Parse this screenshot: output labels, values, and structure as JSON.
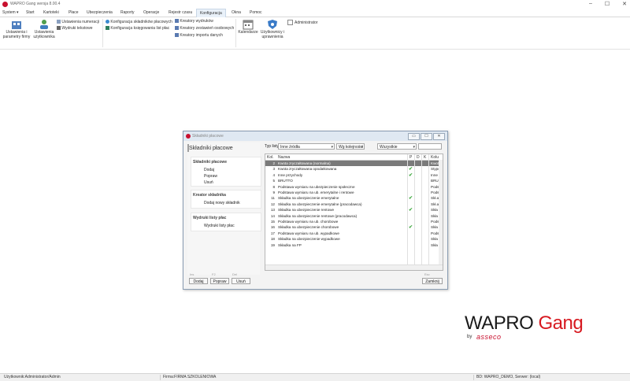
{
  "window": {
    "title": "WAPRO Gang wersja 8.00.4",
    "controls": [
      "–",
      "☐",
      "✕"
    ]
  },
  "menu": {
    "items": [
      "System",
      "Start",
      "Kartoteki",
      "Płace",
      "Ubezpieczenia",
      "Raporty",
      "Operacje",
      "Rejestr czasu",
      "Konfiguracja",
      "Okna",
      "Pomoc"
    ],
    "active": "Konfiguracja"
  },
  "ribbon": {
    "settings_company": [
      "Ustawienia i",
      "parametry firmy"
    ],
    "settings_user": [
      "Ustawienia",
      "użytkownika"
    ],
    "numbering": "Ustawienia numeracji",
    "text_prints": "Wydruki tekstowe",
    "payroll_components": "Konfiguracja składników płacowych",
    "payroll_booking": "Konfiguracja księgowania list płac",
    "print_wizards": "Kreatory wydruków",
    "personal_wizards": "Kreatory zestawień osobowych",
    "import_wizards": "Kreatory importu danych",
    "calendars": "Kalendarze",
    "users": [
      "Użytkownicy i",
      "uprawnienia"
    ],
    "admin": "Administrator"
  },
  "dialog": {
    "title": "Składniki płacowe",
    "controls": [
      "▭",
      "☐",
      "✕"
    ],
    "left": {
      "title": "Składniki płacowe",
      "sections": [
        {
          "header": "Składniki płacowe",
          "links": [
            "Dodaj",
            "Popraw",
            "Usuń"
          ]
        },
        {
          "header": "Kreator składnika",
          "links": [
            "Dodaj nowy składnik"
          ]
        },
        {
          "header": "Wydruki listy płac",
          "links": [
            "Wydruki listy płac"
          ]
        }
      ]
    },
    "filters": {
      "type_label": "Typ listy",
      "type_value": "Inne źródła",
      "order_value": "Wg kolejności",
      "scope_value": "Wszystkie"
    },
    "grid": {
      "headers": [
        "Kol.",
        "Nazwa",
        "P",
        "D",
        "K",
        "Kolu"
      ],
      "rows": [
        {
          "n": "2",
          "name": "Kwota zryczałtowana (normalna)",
          "p": false,
          "d": false,
          "k": false,
          "kol": "Kwot"
        },
        {
          "n": "3",
          "name": "Kwota zryczałtowana opodatkowana",
          "p": true,
          "d": false,
          "k": false,
          "kol": "Stype"
        },
        {
          "n": "4",
          "name": "Inne przychody",
          "p": true,
          "d": false,
          "k": false,
          "kol": "Inne"
        },
        {
          "n": "5",
          "name": "BRUTTO",
          "p": false,
          "d": false,
          "k": false,
          "kol": "BRU"
        },
        {
          "n": "8",
          "name": "Podstawa wymiaru na ubezpieczenie społeczne",
          "p": false,
          "d": false,
          "k": false,
          "kol": "Podst"
        },
        {
          "n": "9",
          "name": "Podstawa wymiaru na ub. emerytalne i rentowe",
          "p": false,
          "d": false,
          "k": false,
          "kol": "Podst"
        },
        {
          "n": "11",
          "name": "Składka na ubezpieczenie emerytalne",
          "p": true,
          "d": false,
          "k": false,
          "kol": "Skł.a"
        },
        {
          "n": "12",
          "name": "Składka na ubezpieczenie emerytalne (pracodawca)",
          "p": false,
          "d": false,
          "k": false,
          "kol": "Skł.a"
        },
        {
          "n": "13",
          "name": "Składka na ubezpieczenie rentowe",
          "p": true,
          "d": false,
          "k": false,
          "kol": "Skła"
        },
        {
          "n": "14",
          "name": "Składka na ubezpieczenie rentowe (pracodawca)",
          "p": false,
          "d": false,
          "k": false,
          "kol": "Skła"
        },
        {
          "n": "15",
          "name": "Podstawa wymiaru na ub. chorobowe",
          "p": false,
          "d": false,
          "k": false,
          "kol": "Podst"
        },
        {
          "n": "16",
          "name": "Składka na ubezpieczenie chorobowe",
          "p": true,
          "d": false,
          "k": false,
          "kol": "Skła"
        },
        {
          "n": "17",
          "name": "Podstawa wymiaru na ub. wypadkowe",
          "p": false,
          "d": false,
          "k": false,
          "kol": "Podst"
        },
        {
          "n": "18",
          "name": "Składka na ubezpieczenie wypadkowe",
          "p": false,
          "d": false,
          "k": false,
          "kol": "Skła"
        },
        {
          "n": "19",
          "name": "Składka na FP",
          "p": false,
          "d": false,
          "k": false,
          "kol": "Skła"
        }
      ]
    },
    "shortcuts": {
      "add": "Ins",
      "edit": "F2",
      "delete": "Del",
      "close": "Esc"
    },
    "buttons": {
      "add": "Dodaj",
      "edit": "Popraw",
      "delete": "Usuń",
      "close": "Zamknij"
    }
  },
  "logo": {
    "wapro": "WAPRO",
    "gang": "Gang",
    "by": "by",
    "asseco": "asseco"
  },
  "status": {
    "user": "Użytkownik:Administrator/Admin",
    "company": "Firma:FIRMA SZKOLENIOWA",
    "db": "BD: WAPRO_DEMO, Serwer: (local)"
  }
}
